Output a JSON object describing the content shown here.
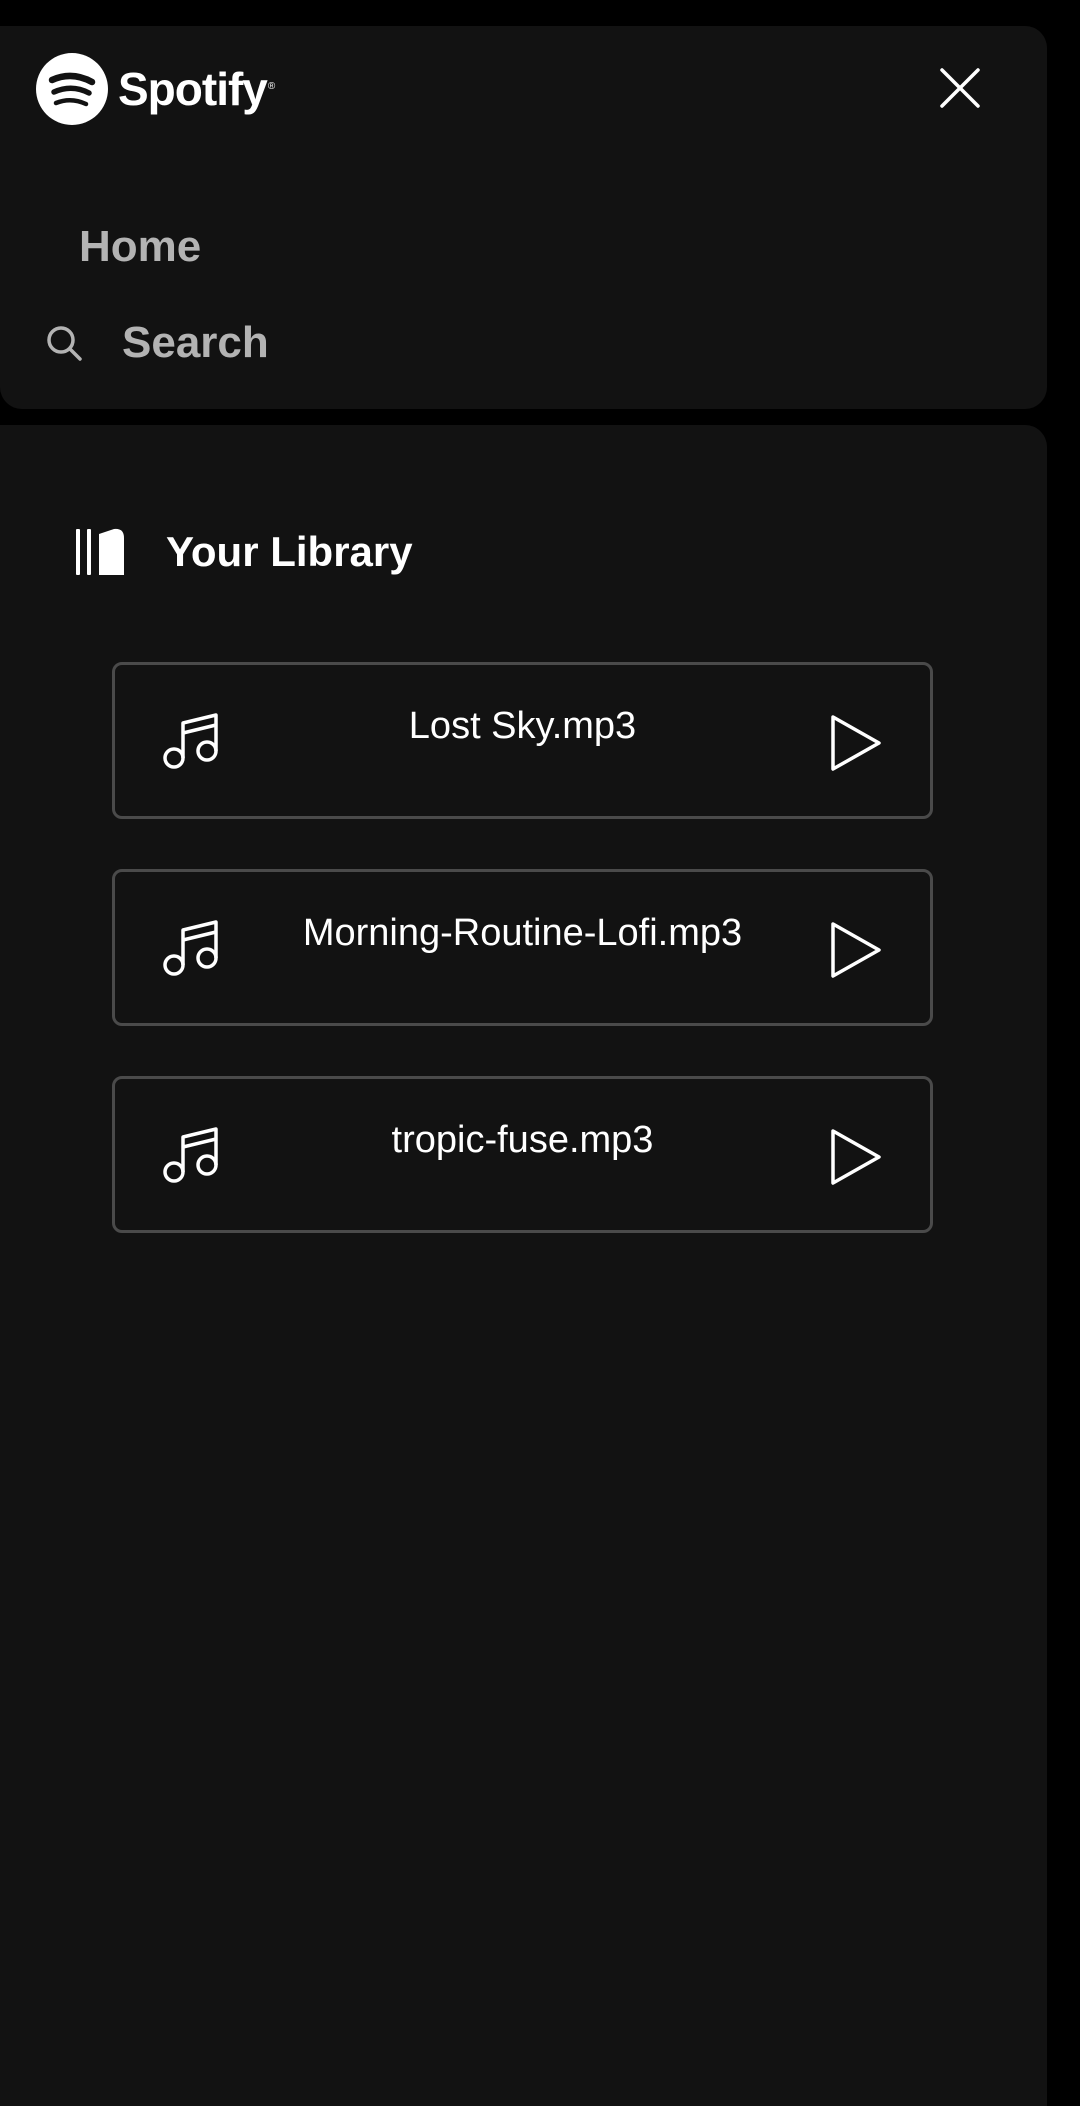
{
  "brand": {
    "name": "Spotify",
    "trademark": "®",
    "logo_icon": "spotify-logo-icon"
  },
  "header": {
    "close_icon": "close-icon"
  },
  "nav": {
    "home_label": "Home",
    "search_label": "Search",
    "search_icon": "search-icon"
  },
  "library": {
    "title": "Your Library",
    "icon": "library-icon",
    "tracks": [
      {
        "name": "Lost Sky.mp3",
        "icon": "music-note-icon",
        "action_icon": "play-icon"
      },
      {
        "name": "Morning-Routine-Lofi.mp3",
        "icon": "music-note-icon",
        "action_icon": "play-icon"
      },
      {
        "name": "tropic-fuse.mp3",
        "icon": "music-note-icon",
        "action_icon": "play-icon"
      }
    ]
  },
  "colors": {
    "background": "#000000",
    "panel": "#121212",
    "text_primary": "#ffffff",
    "text_secondary": "#b3b3b3",
    "track_border": "#4a4a4a"
  }
}
